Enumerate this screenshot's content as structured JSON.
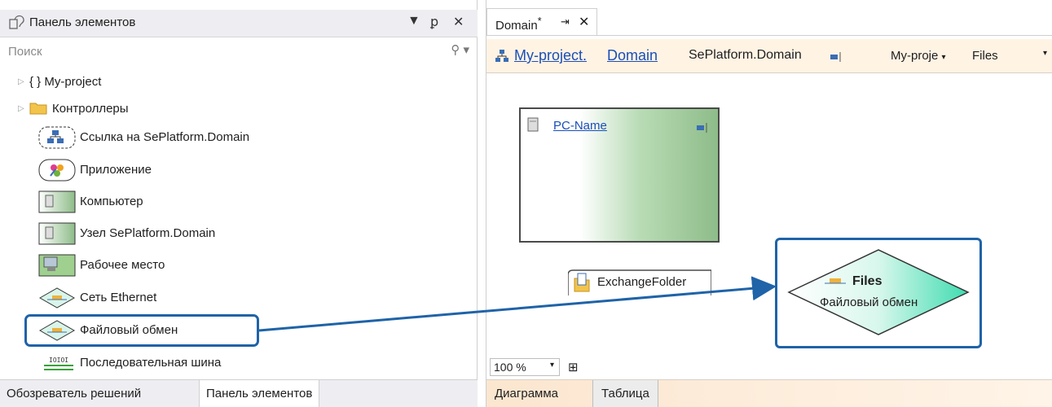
{
  "toolbox": {
    "title": "Панель элементов",
    "pin_glyph": "▼",
    "autohide_glyph": "ᵖ",
    "close_glyph": "✕",
    "search_placeholder": "Поиск",
    "tree": [
      {
        "label": "{ } My-project"
      },
      {
        "label": "Контроллеры"
      }
    ],
    "items": [
      {
        "label": "Ссылка на SePlatform.Domain",
        "icon": "domain-link-icon"
      },
      {
        "label": "Приложение",
        "icon": "application-icon"
      },
      {
        "label": "Компьютер",
        "icon": "computer-icon"
      },
      {
        "label": "Узел SePlatform.Domain",
        "icon": "domain-node-icon"
      },
      {
        "label": "Рабочее место",
        "icon": "workstation-icon"
      },
      {
        "label": "Сеть Ethernet",
        "icon": "ethernet-icon"
      },
      {
        "label": "Файловый обмен",
        "icon": "file-exchange-icon"
      },
      {
        "label": "Последовательная шина",
        "icon": "serial-bus-icon"
      }
    ],
    "bottom_tabs": [
      "Обозреватель решений",
      "Панель элементов"
    ]
  },
  "document": {
    "tab_title": "Domain",
    "tab_modified": "*",
    "tab_close": "✕",
    "tab_pin": "⊕",
    "breadcrumb_project": "My-project.",
    "breadcrumb_domain": "Domain",
    "domain_type": "SePlatform.Domain",
    "combo_project": "My-proje",
    "combo_files": "Files"
  },
  "diagram": {
    "pc_name": "PC-Name",
    "folder_name": "ExchangeFolder",
    "files_title": "Files",
    "files_subtitle": "Файловый обмен",
    "zoom": "100 %",
    "view_tabs": [
      "Диаграмма",
      "Таблица"
    ]
  },
  "colors": {
    "accent": "#1f63a8",
    "link": "#1a4fb8",
    "pc_gradient_end": "#8ebc89",
    "diamond_fill_end": "#3fdcb0"
  }
}
